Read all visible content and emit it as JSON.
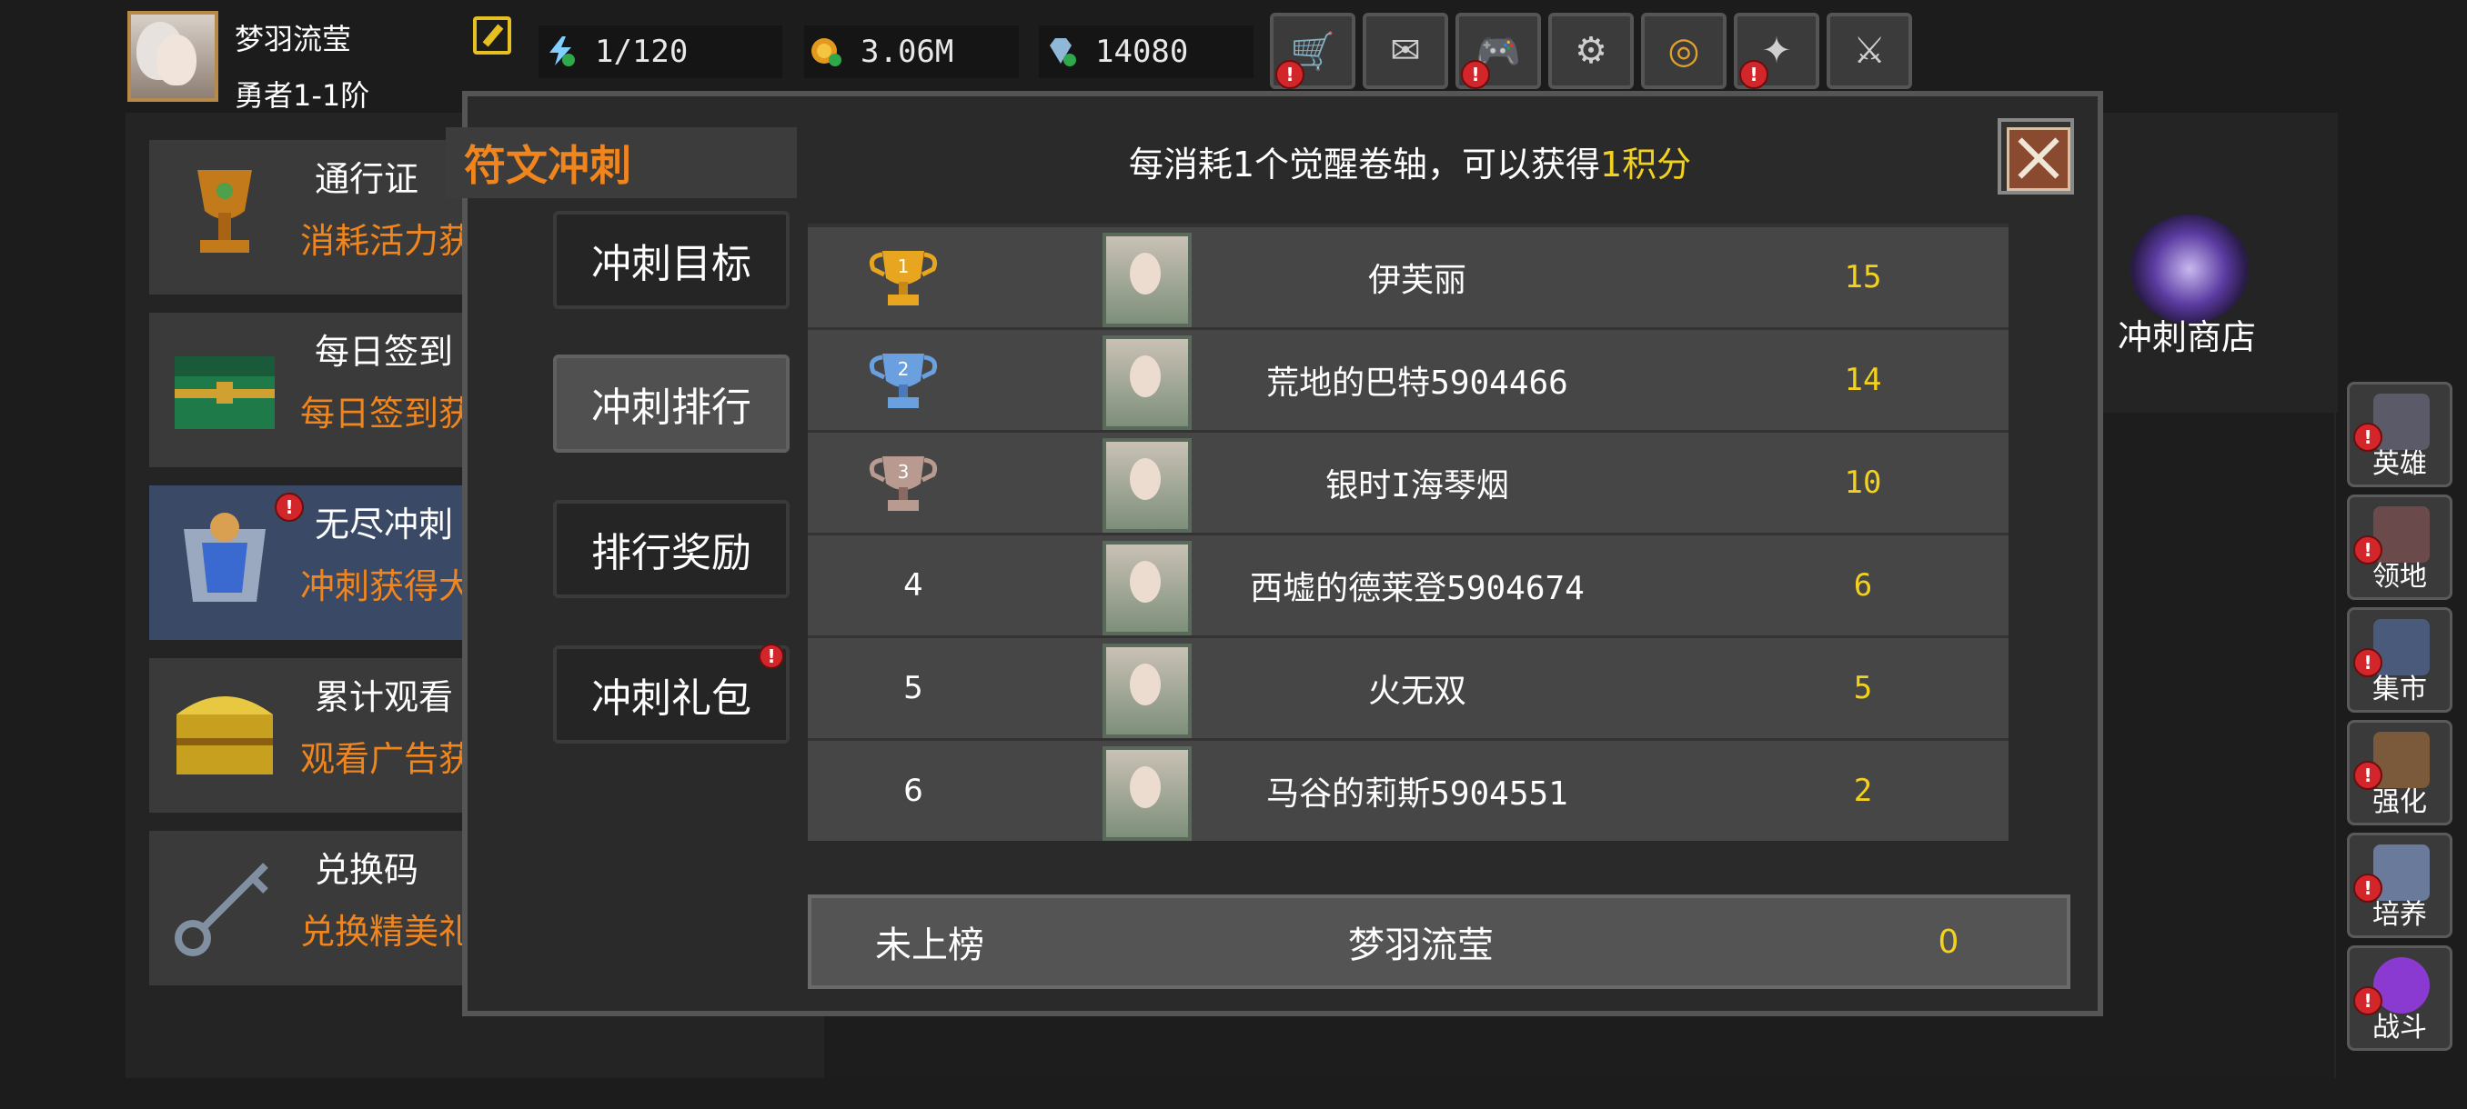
{
  "player": {
    "name": "梦羽流莹",
    "rank": "勇者1-1阶"
  },
  "resources": {
    "energy": "1/120",
    "gold": "3.06M",
    "gems": "14080"
  },
  "top_buttons": [
    {
      "icon": "cart-icon",
      "badge": true
    },
    {
      "icon": "mail-icon",
      "badge": false
    },
    {
      "icon": "gamepad-icon",
      "badge": true
    },
    {
      "icon": "gear-icon",
      "badge": false
    },
    {
      "icon": "color-wheel-icon",
      "badge": false
    },
    {
      "icon": "sparkle-icon",
      "badge": true
    },
    {
      "icon": "crossed-swords-icon",
      "badge": false
    }
  ],
  "left_cards": [
    {
      "title": "通行证",
      "subtitle": "消耗活力获"
    },
    {
      "title": "每日签到",
      "subtitle": "每日签到获"
    },
    {
      "title": "无尽冲刺",
      "subtitle": "冲刺获得大"
    },
    {
      "title": "累计观看",
      "subtitle": "观看广告获"
    },
    {
      "title": "兑换码",
      "subtitle": "兑换精美礼"
    }
  ],
  "shop": {
    "label": "冲刺商店"
  },
  "side_buttons": [
    "英雄",
    "领地",
    "集市",
    "强化",
    "培养",
    "战斗"
  ],
  "dialog": {
    "title": "符文冲刺",
    "hint_prefix": "每消耗1个觉醒卷轴，可以获得",
    "hint_highlight": "1积分",
    "tabs": [
      "冲刺目标",
      "冲刺排行",
      "排行奖励",
      "冲刺礼包"
    ],
    "ranking": [
      {
        "rank": "1",
        "name": "伊芙丽",
        "score": "15",
        "trophy": "gold"
      },
      {
        "rank": "2",
        "name": "荒地的巴特5904466",
        "score": "14",
        "trophy": "silver"
      },
      {
        "rank": "3",
        "name": "银时I海琴烟",
        "score": "10",
        "trophy": "bronze"
      },
      {
        "rank": "4",
        "name": "西墟的德莱登5904674",
        "score": "6",
        "trophy": ""
      },
      {
        "rank": "5",
        "name": "火无双",
        "score": "5",
        "trophy": ""
      },
      {
        "rank": "6",
        "name": "马谷的莉斯5904551",
        "score": "2",
        "trophy": ""
      }
    ],
    "my_row": {
      "status": "未上榜",
      "name": "梦羽流莹",
      "score": "0"
    }
  },
  "colors": {
    "accent_orange": "#f0851d",
    "score_yellow": "#f2d21e",
    "badge_red": "#d2262b"
  }
}
